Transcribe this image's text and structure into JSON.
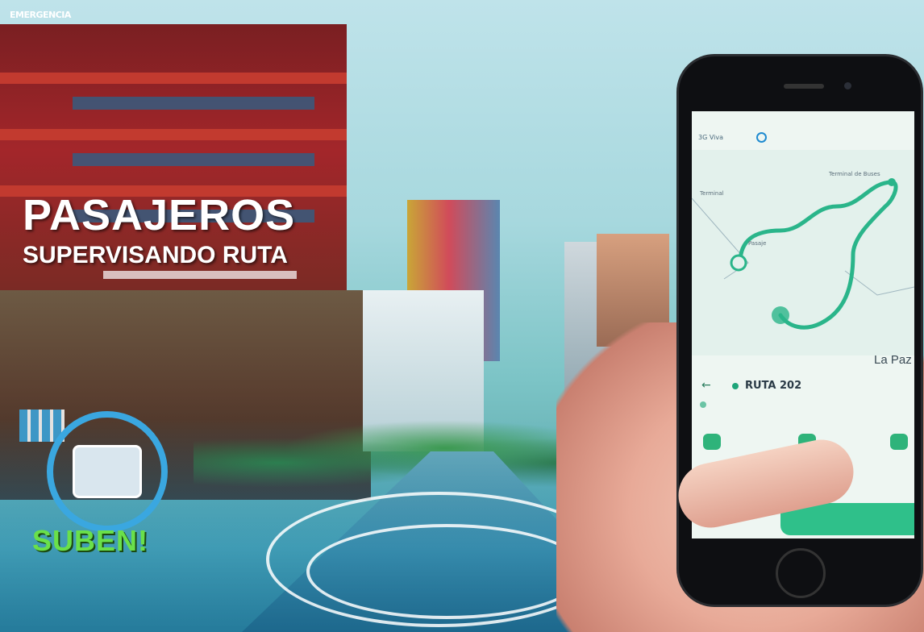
{
  "broadcast": {
    "bug": "EMERGENCIA",
    "headline": "PASAJEROS",
    "subheadline": "SUPERVISANDO RUTA",
    "logo_text": "SUBEN!"
  },
  "phone": {
    "carrier": "3G  Viva",
    "right_status": "",
    "map": {
      "labels": [
        "Terminal",
        "Pasaje",
        "Terminal de Buses"
      ],
      "city": "La Paz"
    },
    "route": {
      "name": "RUTA 202",
      "sub": ""
    },
    "stops": [
      "",
      "",
      ""
    ]
  },
  "colors": {
    "accent_green": "#2eb37a",
    "ring_blue": "#3aa7e0",
    "logo_green": "#6ae04a"
  }
}
